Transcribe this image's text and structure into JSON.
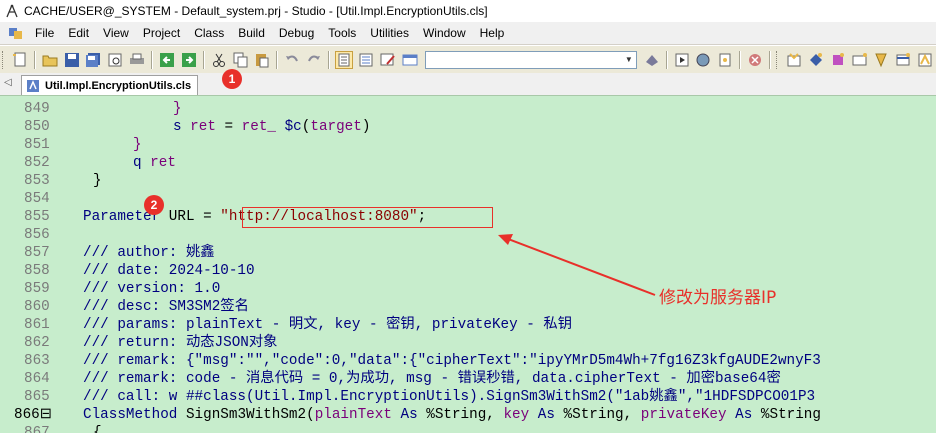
{
  "titlebar": {
    "title": "CACHE/USER@_SYSTEM - Default_system.prj - Studio - [Util.Impl.EncryptionUtils.cls]",
    "icon": "compass-icon"
  },
  "menu": {
    "items": [
      "File",
      "Edit",
      "View",
      "Project",
      "Class",
      "Build",
      "Debug",
      "Tools",
      "Utilities",
      "Window",
      "Help"
    ]
  },
  "toolbar": {
    "combo_value": ""
  },
  "tab": {
    "label": "Util.Impl.EncryptionUtils.cls",
    "badge": "1"
  },
  "annotations": {
    "badge2": "2",
    "note": "修改为服务器IP",
    "color": "#e8302a"
  },
  "editor": {
    "lines": [
      {
        "num": "849",
        "parts": [
          {
            "t": "}",
            "c": "purple"
          }
        ],
        "indent": "indent2"
      },
      {
        "num": "850",
        "parts": [
          {
            "t": "s ",
            "c": "navy"
          },
          {
            "t": "ret",
            "c": "purple"
          },
          {
            "t": " = ",
            "c": "kw"
          },
          {
            "t": "ret_",
            "c": "purple"
          },
          {
            "t": " ",
            "c": "kw"
          },
          {
            "t": "$c",
            "c": "navy"
          },
          {
            "t": "(",
            "c": "kw"
          },
          {
            "t": "target",
            "c": "purple"
          },
          {
            "t": ")",
            "c": "kw"
          }
        ],
        "indent": "indent2"
      },
      {
        "num": "851",
        "parts": [
          {
            "t": "}",
            "c": "purple"
          }
        ],
        "indent": "indent1"
      },
      {
        "num": "852",
        "parts": [
          {
            "t": "q ",
            "c": "navy"
          },
          {
            "t": "ret",
            "c": "purple"
          }
        ],
        "indent": "indent1"
      },
      {
        "num": "853",
        "parts": [
          {
            "t": "}",
            "c": "kw"
          }
        ],
        "indent": "indent1b"
      },
      {
        "num": "854",
        "parts": [],
        "indent": ""
      },
      {
        "num": "855",
        "parts": [
          {
            "t": "Parameter ",
            "c": "navy"
          },
          {
            "t": "URL",
            "c": "kw"
          },
          {
            "t": " = ",
            "c": "kw"
          },
          {
            "t": "\"http://localhost:8080\"",
            "c": "str"
          },
          {
            "t": ";",
            "c": "kw"
          }
        ],
        "indent": ""
      },
      {
        "num": "856",
        "parts": [],
        "indent": ""
      },
      {
        "num": "857",
        "parts": [
          {
            "t": "/// author: 姚鑫",
            "c": "comment"
          }
        ],
        "indent": ""
      },
      {
        "num": "858",
        "parts": [
          {
            "t": "/// date: 2024-10-10",
            "c": "comment"
          }
        ],
        "indent": ""
      },
      {
        "num": "859",
        "parts": [
          {
            "t": "/// version: 1.0",
            "c": "comment"
          }
        ],
        "indent": ""
      },
      {
        "num": "860",
        "parts": [
          {
            "t": "/// desc: SM3SM2签名",
            "c": "comment"
          }
        ],
        "indent": ""
      },
      {
        "num": "861",
        "parts": [
          {
            "t": "/// params: plainText - 明文, key - 密钥, privateKey - 私钥",
            "c": "comment"
          }
        ],
        "indent": ""
      },
      {
        "num": "862",
        "parts": [
          {
            "t": "/// return: 动态JSON对象",
            "c": "comment"
          }
        ],
        "indent": ""
      },
      {
        "num": "863",
        "parts": [
          {
            "t": "/// remark: {\"msg\":\"\",\"code\":0,\"data\":{\"cipherText\":\"ipyYMrD5m4Wh+7fg16Z3kfgAUDE2wnyF3",
            "c": "comment"
          }
        ],
        "indent": ""
      },
      {
        "num": "864",
        "parts": [
          {
            "t": "/// remark: code - 消息代码 = 0,为成功, msg - 错误秒错, data.cipherText - 加密base64密",
            "c": "comment"
          }
        ],
        "indent": ""
      },
      {
        "num": "865",
        "parts": [
          {
            "t": "/// call: w ##class(Util.Impl.EncryptionUtils).SignSm3WithSm2(\"1ab姚鑫\",\"1HDFSDPCO01P3",
            "c": "comment"
          }
        ],
        "indent": ""
      },
      {
        "num": "866⊟",
        "parts": [
          {
            "t": "ClassMethod ",
            "c": "navy"
          },
          {
            "t": "SignSm3WithSm2",
            "c": "kw"
          },
          {
            "t": "(",
            "c": "kw"
          },
          {
            "t": "plainText",
            "c": "purple"
          },
          {
            "t": " As ",
            "c": "navy"
          },
          {
            "t": "%String",
            "c": "kw"
          },
          {
            "t": ", ",
            "c": "kw"
          },
          {
            "t": "key",
            "c": "purple"
          },
          {
            "t": " As ",
            "c": "navy"
          },
          {
            "t": "%String",
            "c": "kw"
          },
          {
            "t": ", ",
            "c": "kw"
          },
          {
            "t": "privateKey",
            "c": "purple"
          },
          {
            "t": " As ",
            "c": "navy"
          },
          {
            "t": "%String",
            "c": "kw"
          }
        ],
        "indent": "",
        "last": true
      },
      {
        "num": "867",
        "parts": [
          {
            "t": "{",
            "c": "kw"
          }
        ],
        "indent": "indent1b"
      }
    ]
  }
}
